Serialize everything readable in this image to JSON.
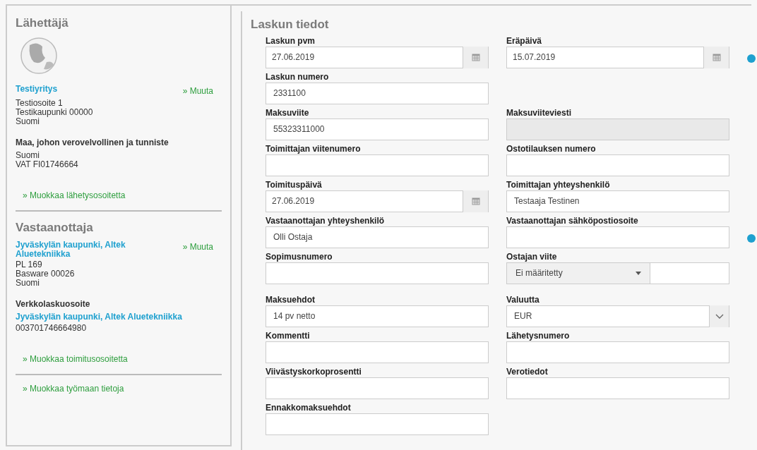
{
  "sender": {
    "heading": "Lähettäjä",
    "name": "Testiyritys",
    "change_link": "» Muuta",
    "address_lines": [
      "Testiosoite 1",
      "Testikaupunki 00000",
      "Suomi"
    ],
    "tax_heading": "Maa, johon verovelvollinen ja tunniste",
    "tax_lines": [
      "Suomi",
      "VAT FI01746664"
    ],
    "edit_link": "» Muokkaa lähetysosoitetta"
  },
  "recipient": {
    "heading": "Vastaanottaja",
    "name": "Jyväskylän kaupunki, Altek Aluetekniikka",
    "change_link": "» Muuta",
    "address_lines": [
      "PL 169",
      "Basware 00026",
      "Suomi"
    ],
    "einvoice_heading": "Verkkolaskuosoite",
    "einvoice_name": "Jyväskylän kaupunki, Altek Aluetekniikka",
    "einvoice_address": "003701746664980",
    "edit_link": "» Muokkaa toimitusosoitetta"
  },
  "worksite_link": "» Muokkaa työmaan tietoja",
  "invoice": {
    "heading": "Laskun tiedot",
    "rows": [
      [
        {
          "label": "Laskun pvm",
          "kind": "date",
          "value": "27.06.2019",
          "info": false
        },
        {
          "label": "Eräpäivä",
          "kind": "date",
          "value": "15.07.2019",
          "info": true
        }
      ],
      [
        {
          "label": "Laskun numero",
          "kind": "text",
          "value": "2331100",
          "info": false
        },
        null
      ],
      [
        {
          "label": "Maksuviite",
          "kind": "text",
          "value": "55323311000",
          "info": false
        },
        {
          "label": "Maksuviiteviesti",
          "kind": "disabled",
          "info": false
        }
      ],
      [
        {
          "label": "Toimittajan viitenumero",
          "kind": "text",
          "info": false
        },
        {
          "label": "Ostotilauksen numero",
          "kind": "text",
          "info": false
        }
      ],
      [
        {
          "label": "Toimituspäivä",
          "kind": "date",
          "value": "27.06.2019",
          "info": false
        },
        {
          "label": "Toimittajan yhteyshenkilö",
          "kind": "text",
          "value": "Testaaja Testinen",
          "info": false
        }
      ],
      [
        {
          "label": "Vastaanottajan yhteyshenkilö",
          "kind": "text",
          "value": "Olli Ostaja",
          "info": false
        },
        {
          "label": "Vastaanottajan sähköpostiosoite",
          "kind": "text",
          "info": true
        }
      ],
      [
        {
          "label": "Sopimusnumero",
          "kind": "text",
          "info": false
        },
        {
          "label": "Ostajan viite",
          "kind": "dropdown_text",
          "value": "Ei määritetty",
          "info": false
        }
      ],
      [
        {
          "label": "Maksuehdot",
          "kind": "text",
          "value": "14 pv netto",
          "info": false
        },
        {
          "label": "Valuutta",
          "kind": "select",
          "value": "EUR",
          "info": false
        }
      ],
      [
        {
          "label": "Kommentti",
          "kind": "text",
          "info": false
        },
        {
          "label": "Lähetysnumero",
          "kind": "text",
          "info": false
        }
      ],
      [
        {
          "label": "Viivästyskorkoprosentti",
          "kind": "text",
          "info": false
        },
        {
          "label": "Verotiedot",
          "kind": "text",
          "info": false
        }
      ],
      [
        {
          "label": "Ennakkomaksuehdot",
          "kind": "text",
          "info": false
        },
        null
      ]
    ]
  }
}
